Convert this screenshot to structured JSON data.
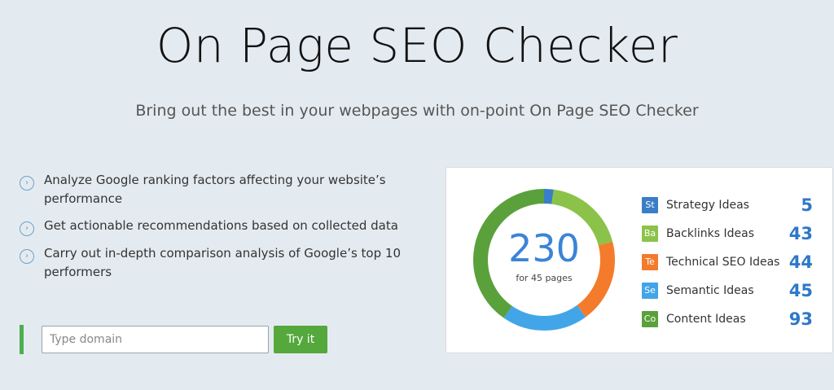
{
  "header": {
    "title": "On Page SEO Checker",
    "subtitle": "Bring out the best in your webpages with on-point On Page SEO Checker"
  },
  "features": [
    {
      "icon": "chevron-right-circle-icon",
      "text": "Analyze Google ranking factors affecting your website’s performance"
    },
    {
      "icon": "chevron-right-circle-icon",
      "text": "Get actionable recommendations based on collected data"
    },
    {
      "icon": "chevron-right-circle-icon",
      "text": "Carry out in-depth comparison analysis of Google’s top 10 performers"
    }
  ],
  "form": {
    "placeholder": "Type domain",
    "button_label": "Try it"
  },
  "summary": {
    "total": "230",
    "subtitle": "for 45 pages"
  },
  "ideas": [
    {
      "badge": "St",
      "label": "Strategy Ideas",
      "count": "5",
      "color": "#3a7ec8"
    },
    {
      "badge": "Ba",
      "label": "Backlinks Ideas",
      "count": "43",
      "color": "#8bc34a"
    },
    {
      "badge": "Te",
      "label": "Technical SEO Ideas",
      "count": "44",
      "color": "#f37b2b"
    },
    {
      "badge": "Se",
      "label": "Semantic Ideas",
      "count": "45",
      "color": "#42a5e8"
    },
    {
      "badge": "Co",
      "label": "Content Ideas",
      "count": "93",
      "color": "#5aa13c"
    }
  ],
  "chart_data": {
    "type": "pie",
    "style": "donut",
    "categories": [
      "Strategy Ideas",
      "Backlinks Ideas",
      "Technical SEO Ideas",
      "Semantic Ideas",
      "Content Ideas"
    ],
    "values": [
      5,
      43,
      44,
      45,
      93
    ],
    "colors": [
      "#3a7ec8",
      "#8bc34a",
      "#f37b2b",
      "#42a5e8",
      "#5aa13c"
    ]
  }
}
